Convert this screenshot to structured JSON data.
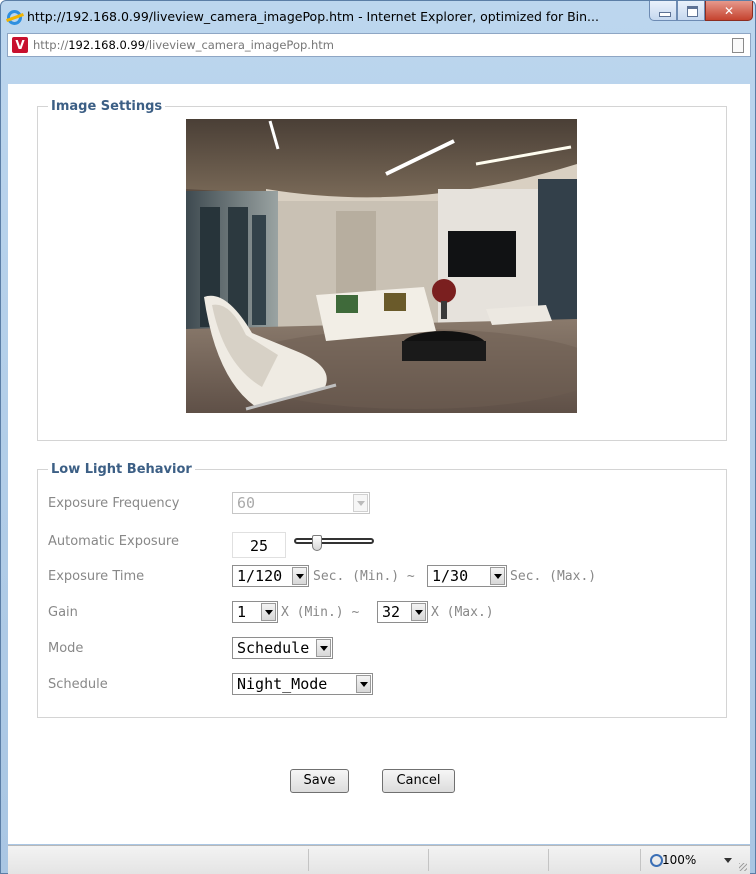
{
  "window": {
    "title": "http://192.168.0.99/liveview_camera_imagePop.htm - Internet Explorer, optimized for Bin...",
    "minimize_glyph": "",
    "close_glyph": "✕"
  },
  "address": {
    "url_prefix": "http://",
    "url_host": "192.168.0.99",
    "url_path": "/liveview_camera_imagePop.htm",
    "site_icon_glyph": "V"
  },
  "image_settings": {
    "legend": "Image Settings"
  },
  "low_light": {
    "legend": "Low Light Behavior",
    "exposure_frequency": {
      "label": "Exposure Frequency",
      "value": "60"
    },
    "automatic_exposure": {
      "label": "Automatic Exposure",
      "value": "25",
      "level": 0.3
    },
    "exposure_time": {
      "label": "Exposure Time",
      "min_value": "1/120",
      "min_unit": "Sec. (Min.) ~",
      "max_value": "1/30",
      "max_unit": "Sec. (Max.)"
    },
    "gain": {
      "label": "Gain",
      "min_value": "1",
      "min_unit": "X (Min.) ~",
      "max_value": "32",
      "max_unit": "X (Max.)"
    },
    "mode": {
      "label": "Mode",
      "value": "Schedule"
    },
    "schedule": {
      "label": "Schedule",
      "value": "Night_Mode"
    }
  },
  "actions": {
    "save": "Save",
    "cancel": "Cancel"
  },
  "status": {
    "zoom": "100%"
  }
}
